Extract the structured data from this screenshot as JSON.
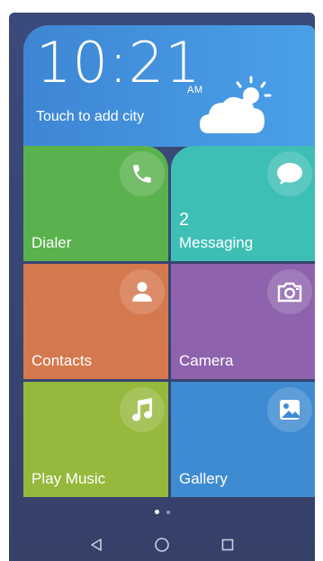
{
  "weather": {
    "time": "10:21",
    "ampm": "AM",
    "city_prompt": "Touch to add city",
    "icon": "partly-cloudy-icon"
  },
  "tiles": [
    {
      "label": "Dialer",
      "icon": "phone-icon",
      "color": "#5ab24e"
    },
    {
      "label": "Messaging",
      "count": "2",
      "icon": "chat-bubble-icon",
      "color": "#3dbfb5"
    },
    {
      "label": "Contacts",
      "icon": "person-icon",
      "color": "#d4784e"
    },
    {
      "label": "Camera",
      "icon": "camera-icon",
      "color": "#8e62ad"
    },
    {
      "label": "Play Music",
      "icon": "music-note-icon",
      "color": "#95b93c"
    },
    {
      "label": "Gallery",
      "icon": "image-icon",
      "color": "#3f8bd1"
    }
  ],
  "page_indicator": {
    "pages": 2,
    "current": 1
  },
  "navbar": {
    "back_icon": "back-triangle-icon",
    "home_icon": "home-circle-icon",
    "recents_icon": "recents-square-icon"
  }
}
